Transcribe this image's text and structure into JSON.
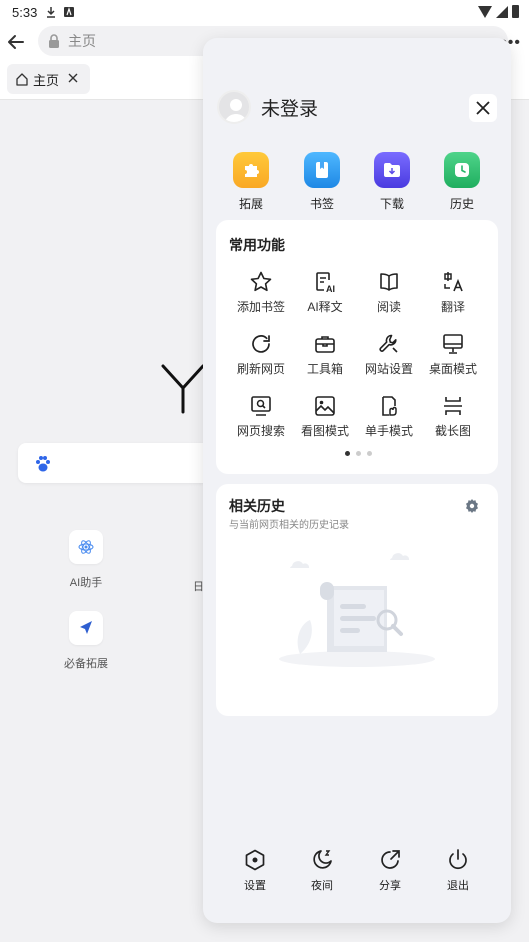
{
  "status_bar": {
    "time": "5:33"
  },
  "address_bar": {
    "text": "主页"
  },
  "tab": {
    "label": "主页"
  },
  "background": {
    "tiles": [
      {
        "label": "AI助手"
      },
      {
        "label": "必备拓展"
      }
    ],
    "partial_tile_label": "日"
  },
  "panel": {
    "user_name": "未登录",
    "quick_actions": [
      {
        "label": "拓展",
        "color": "#f9a825",
        "icon": "puzzle-icon"
      },
      {
        "label": "书签",
        "color": "#2196f3",
        "icon": "bookmark-book-icon"
      },
      {
        "label": "下载",
        "color": "#5b4be7",
        "icon": "download-folder-icon"
      },
      {
        "label": "历史",
        "color": "#26b66a",
        "icon": "clock-icon"
      }
    ],
    "common_functions": {
      "title": "常用功能",
      "items": [
        {
          "label": "添加书签",
          "icon": "star-icon"
        },
        {
          "label": "AI释文",
          "icon": "ai-text-icon"
        },
        {
          "label": "阅读",
          "icon": "book-open-icon"
        },
        {
          "label": "翻译",
          "icon": "translate-icon"
        },
        {
          "label": "刷新网页",
          "icon": "refresh-icon"
        },
        {
          "label": "工具箱",
          "icon": "toolbox-icon"
        },
        {
          "label": "网站设置",
          "icon": "wrench-icon"
        },
        {
          "label": "桌面模式",
          "icon": "desktop-icon"
        },
        {
          "label": "网页搜索",
          "icon": "page-search-icon"
        },
        {
          "label": "看图模式",
          "icon": "image-icon"
        },
        {
          "label": "单手模式",
          "icon": "one-hand-icon"
        },
        {
          "label": "截长图",
          "icon": "long-screenshot-icon"
        }
      ],
      "page_indicator": {
        "total": 3,
        "active": 1
      }
    },
    "related_history": {
      "title": "相关历史",
      "subtitle": "与当前网页相关的历史记录"
    },
    "bottom_actions": [
      {
        "label": "设置",
        "icon": "settings-hex-icon"
      },
      {
        "label": "夜间",
        "icon": "moon-icon"
      },
      {
        "label": "分享",
        "icon": "share-icon"
      },
      {
        "label": "退出",
        "icon": "power-icon"
      }
    ]
  }
}
